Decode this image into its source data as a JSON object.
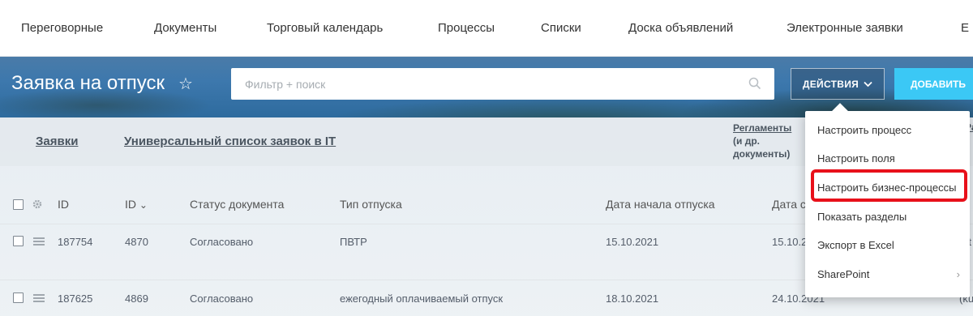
{
  "topnav": {
    "items": [
      "Переговорные",
      "Документы",
      "Торговый календарь",
      "Процессы",
      "Списки",
      "Доска объявлений",
      "Электронные заявки",
      "Е"
    ]
  },
  "header": {
    "title": "Заявка на отпуск",
    "star": "☆",
    "search_placeholder": "Фильтр + поиск",
    "actions_label": "ДЕЙСТВИЯ",
    "add_label": "ДОБАВИТЬ"
  },
  "sections": {
    "link1": "Заявки",
    "link2": "Универсальный список заявок в IT",
    "reg_title": "Регламенты",
    "reg_sub1": "(и др.",
    "reg_sub2": "документы)",
    "edge": "Ра"
  },
  "table": {
    "headers": [
      "ID",
      "ID",
      "Статус документа",
      "Тип отпуска",
      "Дата начала отпуска",
      "Дата с"
    ],
    "sort_indicator": "⌄",
    "rows": [
      {
        "id": "187754",
        "id2": "4870",
        "status": "Согласовано",
        "type": "ПВТР",
        "start": "15.10.2021",
        "end": "15.10.2",
        "edge": "(t"
      },
      {
        "id": "187625",
        "id2": "4869",
        "status": "Согласовано",
        "type": "ежегодный оплачиваемый отпуск",
        "start": "18.10.2021",
        "end": "24.10.2021",
        "edge": "(kuz"
      }
    ]
  },
  "dropdown": {
    "items": [
      "Настроить процесс",
      "Настроить поля",
      "Настроить бизнес-процессы",
      "Показать разделы",
      "Экспорт в Excel",
      "SharePoint"
    ],
    "chevron": "›"
  },
  "colors": {
    "accent_add": "#3bc8f5",
    "highlight": "#e8101a"
  }
}
